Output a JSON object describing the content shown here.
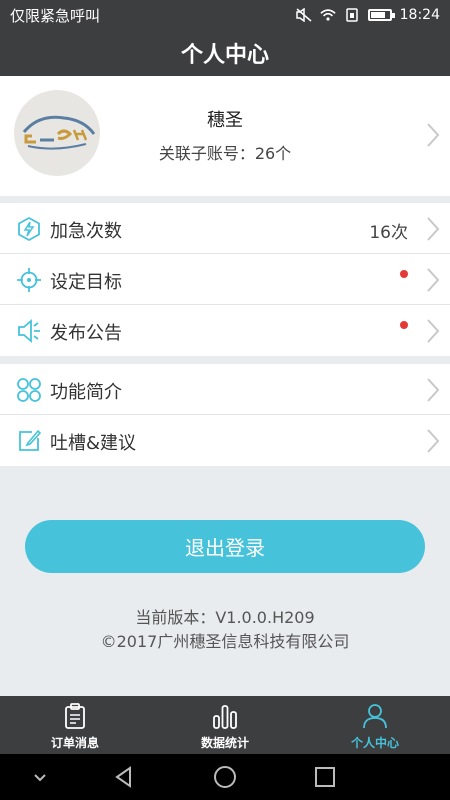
{
  "status_bar": {
    "carrier": "仅限紧急呼叫",
    "time": "18:24"
  },
  "header": {
    "title": "个人中心"
  },
  "profile": {
    "name": "穗圣",
    "sub_label": "关联子账号：26个"
  },
  "menu_group_1": [
    {
      "label": "加急次数",
      "value": "16次",
      "icon": "lightning-icon"
    },
    {
      "label": "设定目标",
      "icon": "target-icon",
      "badge": true
    },
    {
      "label": "发布公告",
      "icon": "speaker-icon",
      "badge": true
    }
  ],
  "menu_group_2": [
    {
      "label": "功能简介",
      "icon": "grid-circles-icon"
    },
    {
      "label": "吐槽&建议",
      "icon": "edit-icon"
    }
  ],
  "logout": {
    "label": "退出登录"
  },
  "version": {
    "line1": "当前版本：V1.0.0.H209",
    "line2": "©2017广州穗圣信息科技有限公司"
  },
  "tabbar": {
    "tabs": [
      {
        "label": "订单消息",
        "icon": "clipboard-icon",
        "active": false
      },
      {
        "label": "数据统计",
        "icon": "bar-chart-icon",
        "active": false
      },
      {
        "label": "个人中心",
        "icon": "person-icon",
        "active": true
      }
    ]
  },
  "colors": {
    "accent": "#46c3db",
    "dark": "#3d3e40",
    "badge": "#e53935"
  }
}
